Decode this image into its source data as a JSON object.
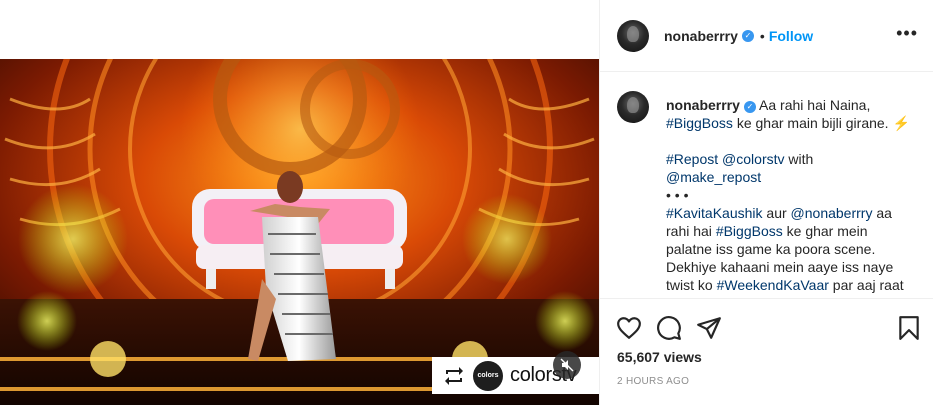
{
  "post": {
    "author": {
      "username": "nonaberrry",
      "verified": true
    },
    "follow_label": "Follow",
    "separator": "•",
    "more_label": "•••",
    "media": {
      "repost_brand": "colorstv",
      "brand_logo_text": "colors",
      "muted": true
    },
    "caption": {
      "username": "nonaberrry",
      "line1": "Aa rahi hai Naina,",
      "hashtag1": "#BiggBoss",
      "line1_rest": " ke ghar main bijli girane. ⚡",
      "repost_tag": "#Repost",
      "repost_mention": "@colorstv",
      "with_text": " with",
      "make_repost": "@make_repost",
      "dots": "•  •  •",
      "tag_kavita": "#KavitaKaushik",
      "aur": " aur ",
      "mention_nona": "@nonaberrry",
      "aa_rahi_hai": " aa rahi hai ",
      "hashtag2": "#BiggBoss",
      "line_rest2": " ke ghar mein palatne iss game ka poora scene. Dekhiye kahaani mein aaye iss naye twist ko ",
      "hashtag3": "#WeekendKaVaar",
      "line_end": " par aaj raat"
    },
    "views": "65,607 views",
    "timestamp": "2 HOURS AGO"
  },
  "colors": {
    "accent_blue": "#0095f6",
    "verified_blue": "#3897f0",
    "tag_blue": "#00376b",
    "muted_gray": "#8e8e8e"
  },
  "icons": [
    "heart-icon",
    "comment-icon",
    "share-icon",
    "bookmark-icon",
    "repost-icon",
    "mute-icon",
    "more-icon",
    "verified-badge-icon"
  ]
}
